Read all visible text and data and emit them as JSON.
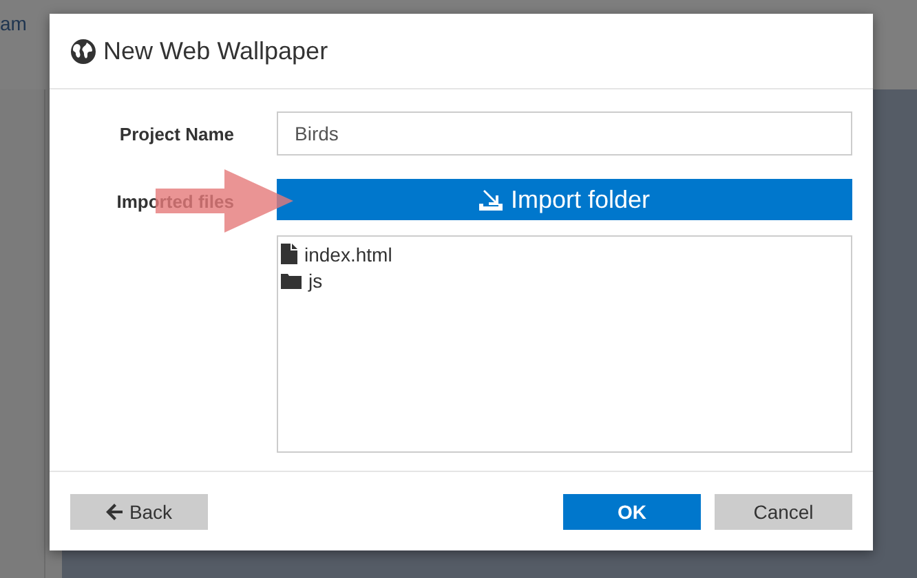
{
  "background": {
    "text": "am"
  },
  "dialog": {
    "title": "New Web Wallpaper",
    "fields": [
      {
        "kind": "text",
        "label": "Project Name",
        "value": "Birds"
      },
      {
        "kind": "files",
        "label": "Imported files",
        "button": "Import folder",
        "files": [
          {
            "kind": "file",
            "name": "index.html"
          },
          {
            "kind": "folder",
            "name": "js"
          }
        ]
      }
    ],
    "footer": {
      "back": "Back",
      "ok": "OK",
      "cancel": "Cancel"
    }
  }
}
